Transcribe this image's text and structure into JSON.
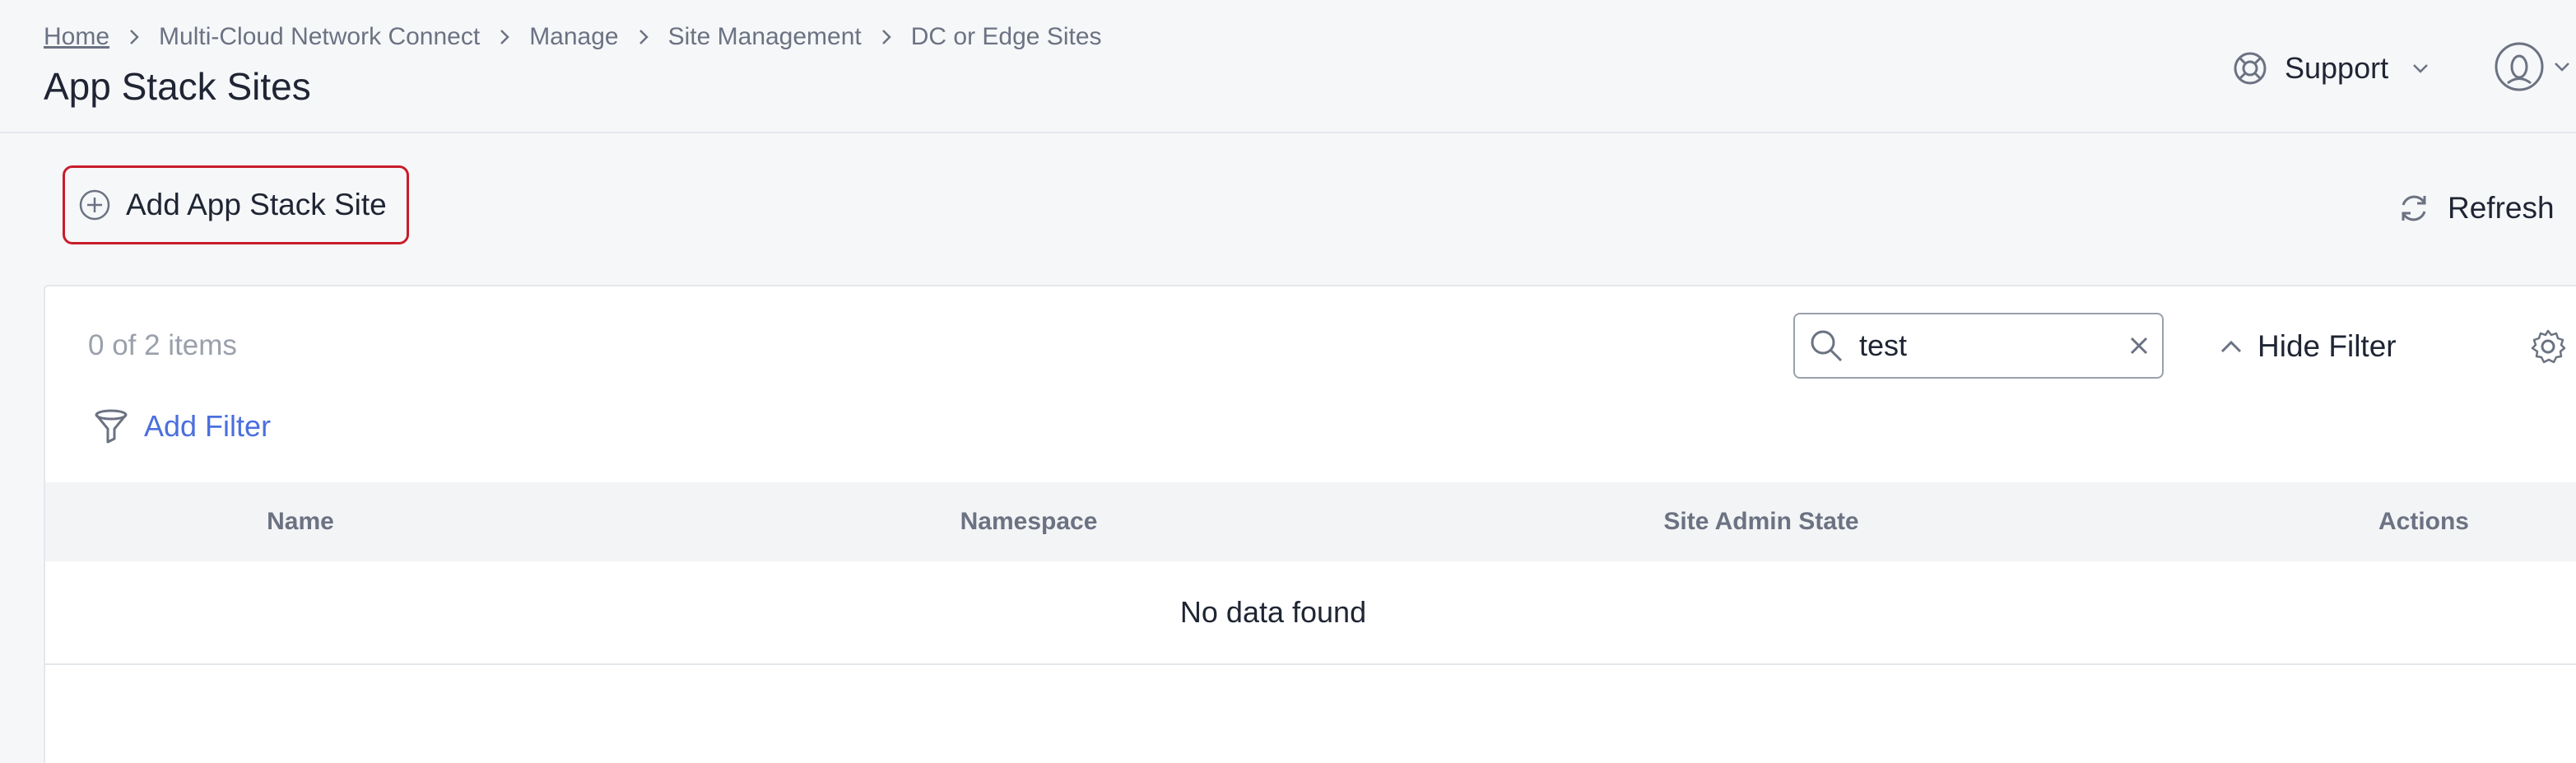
{
  "breadcrumb": {
    "items": [
      "Home",
      "Multi-Cloud Network Connect",
      "Manage",
      "Site Management",
      "DC or Edge Sites"
    ]
  },
  "page": {
    "title": "App Stack Sites"
  },
  "header": {
    "support_label": "Support"
  },
  "toolbar": {
    "add_label": "Add App Stack Site",
    "refresh_label": "Refresh"
  },
  "list": {
    "count_text": "0 of 2 items",
    "search_value": "test",
    "hide_filter_label": "Hide Filter",
    "add_filter_label": "Add Filter",
    "columns": [
      "Name",
      "Namespace",
      "Site Admin State",
      "Actions"
    ],
    "empty_text": "No data found"
  },
  "colors": {
    "accent": "#4b6fde",
    "highlight_border": "#c81d2a",
    "text": "#1f2533",
    "muted": "#6b7282"
  },
  "icons": [
    "chevron-right-icon",
    "support-lifebuoy-icon",
    "chevron-down-icon",
    "user-avatar-icon",
    "plus-circle-icon",
    "refresh-icon",
    "search-icon",
    "clear-icon",
    "chevron-up-icon",
    "gear-icon",
    "filter-funnel-icon"
  ]
}
